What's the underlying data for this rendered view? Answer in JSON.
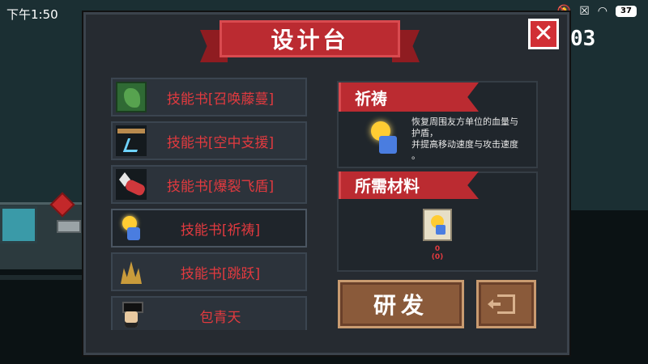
{
  "status_bar": {
    "time": "下午1:50",
    "battery": "37"
  },
  "dialog": {
    "title": "设计台",
    "counter": "03"
  },
  "recipes": [
    {
      "label": "技能书[召唤藤蔓]",
      "icon": "vine-icon"
    },
    {
      "label": "技能书[空中支援]",
      "icon": "air-support-icon"
    },
    {
      "label": "技能书[爆裂飞盾]",
      "icon": "flying-shield-icon"
    },
    {
      "label": "技能书[祈祷]",
      "icon": "prayer-icon",
      "selected": true
    },
    {
      "label": "技能书[跳跃]",
      "icon": "jump-icon"
    },
    {
      "label": "包青天",
      "icon": "bao-qingtian-icon"
    }
  ],
  "skill": {
    "name": "祈祷",
    "description_line1": "恢复周围友方单位的血量与",
    "description_line2": "护盾，",
    "description_line3": "并提高移动速度与攻击速度",
    "description_line4": "。"
  },
  "materials": {
    "title": "所需材料",
    "count_have": "0",
    "count_need": "(0)"
  },
  "buttons": {
    "develop": "研发"
  }
}
